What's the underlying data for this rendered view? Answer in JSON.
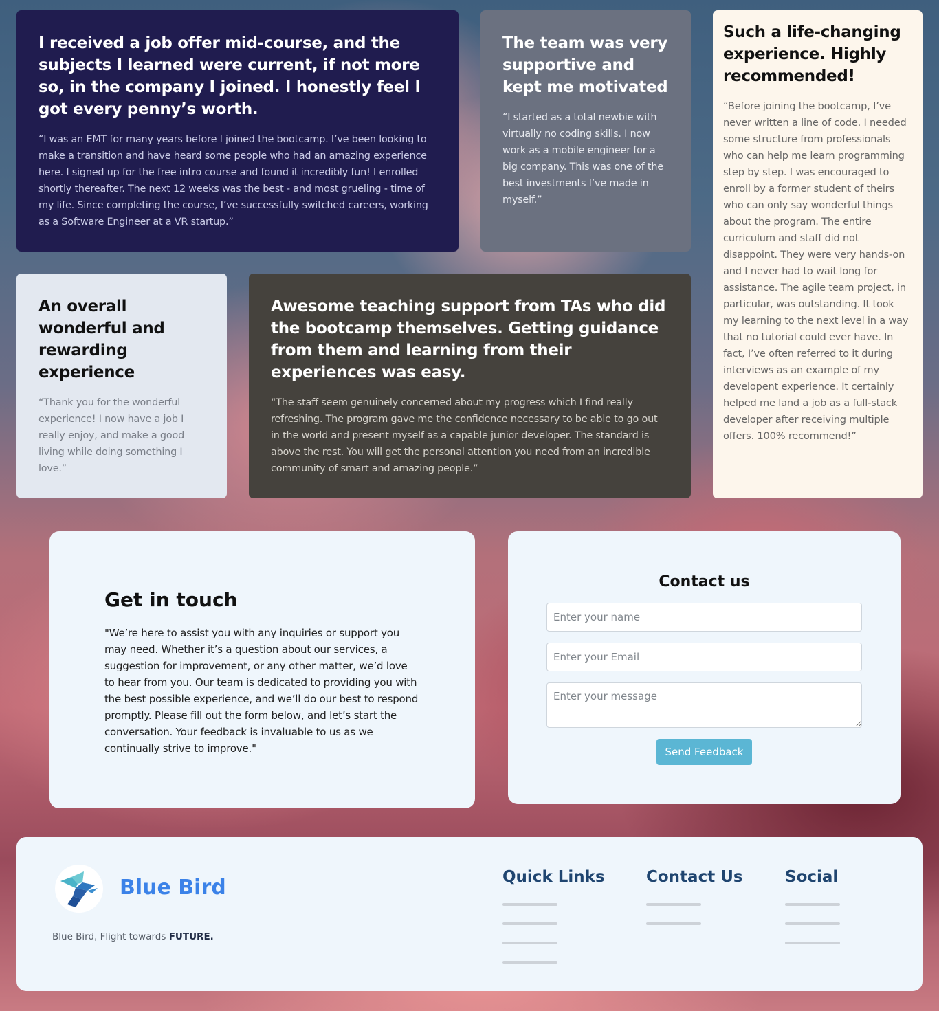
{
  "testimonials": [
    {
      "title": "I received a job offer mid-course, and the subjects I learned were current, if not more so, in the company I joined. I honestly feel I got every penny’s worth.",
      "quote": "“I was an EMT for many years before I joined the bootcamp. I’ve been looking to make a transition and have heard some people who had an amazing experience here. I signed up for the free intro course and found it incredibly fun! I enrolled shortly thereafter. The next 12 weeks was the best - and most grueling - time of my life. Since completing the course, I’ve successfully switched careers, working as a Software Engineer at a VR startup.”",
      "bg": "#201c4f"
    },
    {
      "title": "The team was very supportive and kept me motivated",
      "quote": "“I started as a total newbie with virtually no coding skills. I now work as a mobile engineer for a big company. This was one of the best investments I’ve made in myself.”",
      "bg": "#6b7180"
    },
    {
      "title": "Such a life-changing experience. Highly recommended!",
      "quote": "“Before joining the bootcamp, I’ve never written a line of code. I needed some structure from professionals who can help me learn programming step by step. I was encouraged to enroll by a former student of theirs who can only say wonderful things about the program. The entire curriculum and staff did not disappoint. They were very hands-on and I never had to wait long for assistance. The agile team project, in particular, was outstanding. It took my learning to the next level in a way that no tutorial could ever have. In fact, I’ve often referred to it during interviews as an example of my developent experience. It certainly helped me land a job as a full-stack developer after receiving multiple offers. 100% recommend!”",
      "bg": "#fdf6ec"
    },
    {
      "title": "An overall wonderful and rewarding experience",
      "quote": "“Thank you for the wonderful experience! I now have a job I really enjoy, and make a good living while doing something I love.”",
      "bg": "#e3e8f0"
    },
    {
      "title": "Awesome teaching support from TAs who did the bootcamp themselves. Getting guidance from them and learning from their experiences was easy.",
      "quote": "“The staff seem genuinely concerned about my progress which I find really refreshing. The program gave me the confidence necessary to be able to go out in the world and present myself as a capable junior developer. The standard is above the rest. You will get the personal attention you need from an incredible community of smart and amazing people.”",
      "bg": "#45423d"
    }
  ],
  "get_in_touch": {
    "heading": "Get in touch",
    "body": "\"We’re here to assist you with any inquiries or support you may need. Whether it’s a question about our services, a suggestion for improvement, or any other matter, we’d love to hear from you. Our team is dedicated to providing you with the best possible experience, and we’ll do our best to respond promptly. Please fill out the form below, and let’s start the conversation. Your feedback is invaluable to us as we continually strive to improve.\""
  },
  "contact_form": {
    "heading": "Contact us",
    "name_placeholder": "Enter your name",
    "email_placeholder": "Enter your Email",
    "message_placeholder": "Enter your message",
    "submit_label": "Send Feedback",
    "accent": "#5bb6d4"
  },
  "footer": {
    "brand": "Blue Bird",
    "logo_icon": "blue-bird-logo",
    "tagline_prefix": "Blue Bird, Flight towards ",
    "tagline_emphasis": "FUTURE.",
    "columns": [
      {
        "heading": "Quick Links"
      },
      {
        "heading": "Contact Us"
      },
      {
        "heading": "Social"
      }
    ],
    "brand_color": "#3b82e8",
    "heading_color": "#1f4570"
  }
}
